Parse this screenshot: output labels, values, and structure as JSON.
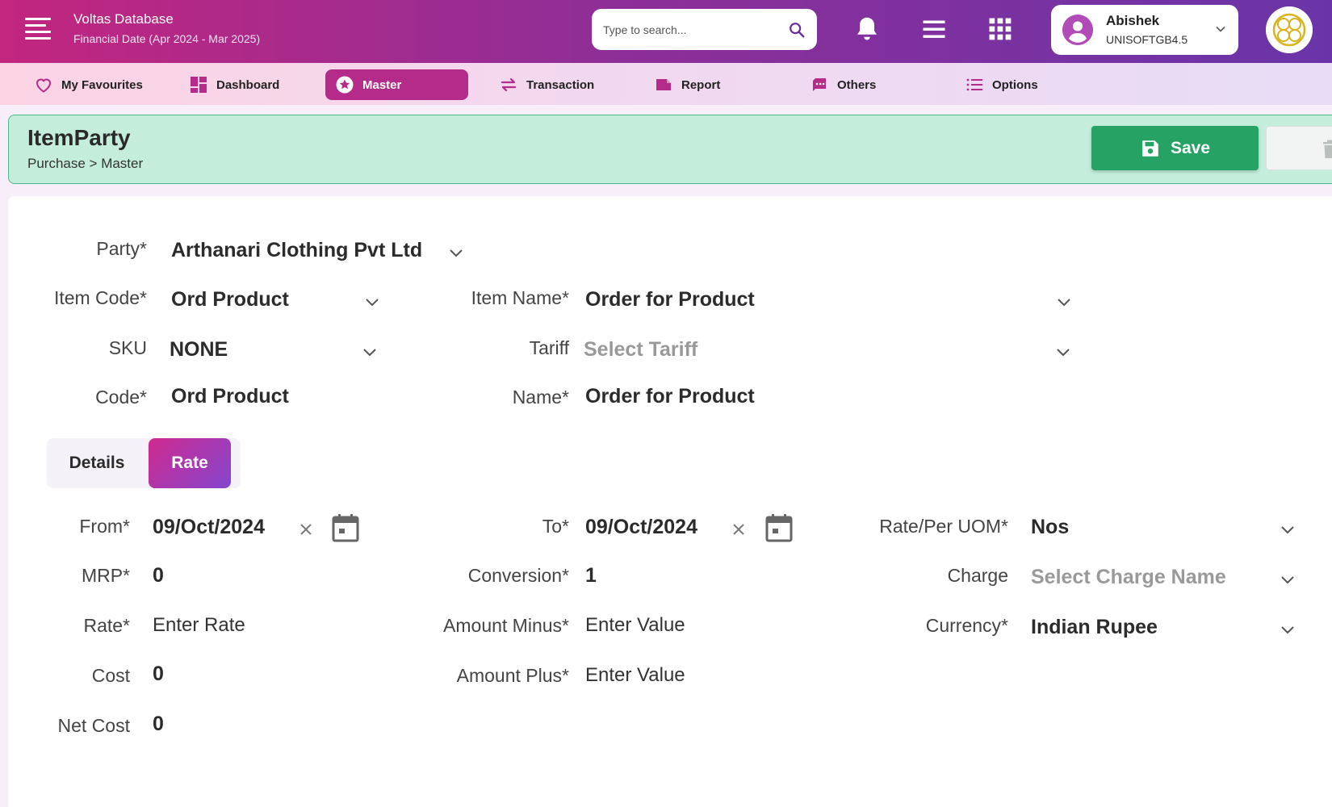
{
  "header": {
    "app_title": "Voltas Database",
    "financial_date": "Financial Date (Apr 2024 - Mar 2025)",
    "search_placeholder": "Type to search...",
    "user_name": "Abishek",
    "user_code": "UNISOFTGB4.5"
  },
  "nav": {
    "favourites": "My Favourites",
    "dashboard": "Dashboard",
    "master": "Master",
    "transaction": "Transaction",
    "report": "Report",
    "others": "Others",
    "options": "Options",
    "active": "Master"
  },
  "page": {
    "title": "ItemParty",
    "breadcrumb": "Purchase > Master",
    "save_label": "Save"
  },
  "form": {
    "party_label": "Party*",
    "party_value": "Arthanari Clothing Pvt Ltd",
    "item_code_label": "Item Code*",
    "item_code_value": "Ord Product",
    "item_name_label": "Item Name*",
    "item_name_value": "Order for Product",
    "sku_label": "SKU",
    "sku_value": "NONE",
    "tariff_label": "Tariff",
    "tariff_placeholder": "Select Tariff",
    "code_label": "Code*",
    "code_value": "Ord Product",
    "name_label": "Name*",
    "name_value": "Order for Product"
  },
  "tabs": {
    "details": "Details",
    "rate": "Rate",
    "active": "Rate"
  },
  "rate": {
    "from_label": "From*",
    "from_value": "09/Oct/2024",
    "to_label": "To*",
    "to_value": "09/Oct/2024",
    "uom_label": "Rate/Per UOM*",
    "uom_value": "Nos",
    "mrp_label": "MRP*",
    "mrp_value": "0",
    "conversion_label": "Conversion*",
    "conversion_value": "1",
    "charge_label": "Charge",
    "charge_placeholder": "Select Charge Name",
    "rate_label": "Rate*",
    "rate_placeholder": "Enter Rate",
    "amount_minus_label": "Amount Minus*",
    "amount_minus_placeholder": "Enter Value",
    "currency_label": "Currency*",
    "currency_value": "Indian Rupee",
    "cost_label": "Cost",
    "cost_value": "0",
    "amount_plus_label": "Amount Plus*",
    "amount_plus_placeholder": "Enter Value",
    "net_cost_label": "Net Cost",
    "net_cost_value": "0"
  },
  "colors": {
    "header_gradient_start": "#c2267f",
    "header_gradient_end": "#6a34a8",
    "active_nav": "#b42b8a",
    "page_head_bg": "#c4eedb",
    "save_button": "#27a265",
    "rate_tab_start": "#cf2a8e",
    "rate_tab_end": "#8446cf"
  },
  "icons": {
    "menu": "hamburger-icon",
    "search": "search-icon",
    "bell": "bell-icon",
    "list": "list-menu-icon",
    "apps": "apps-grid-icon",
    "favourites": "heart-icon",
    "dashboard": "dashboard-icon",
    "master": "star-badge-icon",
    "transaction": "swap-arrows-icon",
    "report": "report-icon",
    "others": "chat-icon",
    "options": "options-list-icon",
    "save": "floppy-disk-icon",
    "delete": "trash-icon",
    "calendar": "calendar-icon",
    "clear": "close-icon",
    "dropdown": "chevron-down-icon"
  }
}
